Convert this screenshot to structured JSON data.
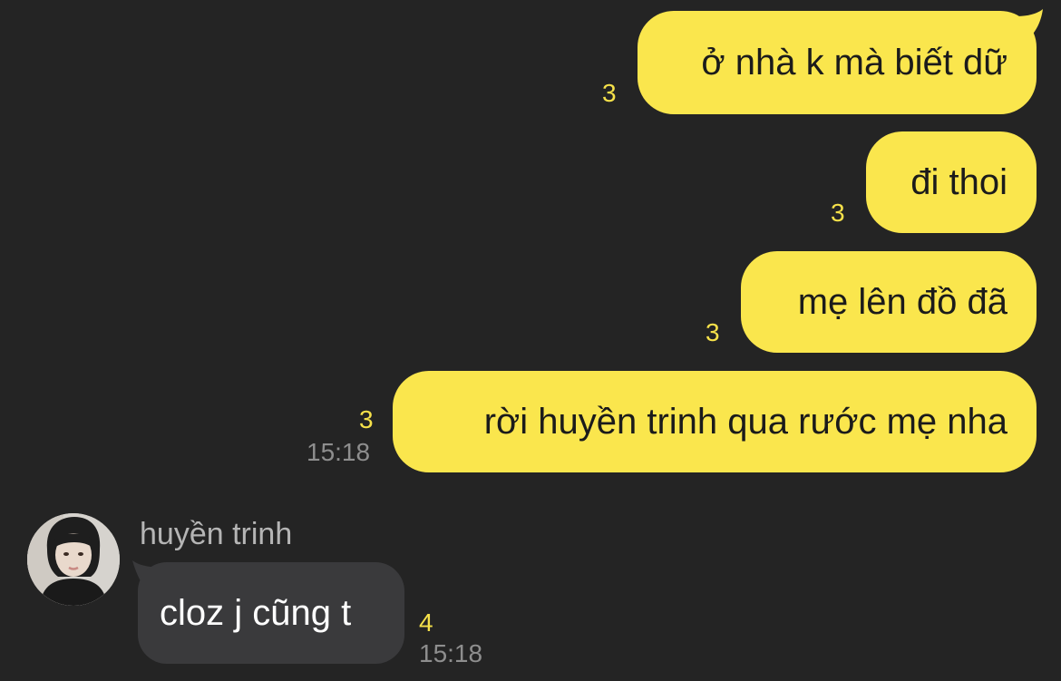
{
  "colors": {
    "background": "#242424",
    "outgoing_bubble": "#fae64d",
    "incoming_bubble": "#3a3a3c",
    "unread_count": "#f6e14a",
    "timestamp": "#8e8e8e"
  },
  "outgoing": [
    {
      "text": "ở nhà k mà biết dữ",
      "unread": "3"
    },
    {
      "text": "đi thoi",
      "unread": "3"
    },
    {
      "text": "mẹ lên đồ đã",
      "unread": "3"
    },
    {
      "text": "rời huyền trinh qua rước mẹ nha",
      "unread": "3",
      "time": "15:18"
    }
  ],
  "incoming": {
    "sender_name": "huyền trinh",
    "avatar_icon": "profile-photo",
    "messages": [
      {
        "text": "cloz j cũng t",
        "unread": "4",
        "time": "15:18"
      }
    ]
  }
}
